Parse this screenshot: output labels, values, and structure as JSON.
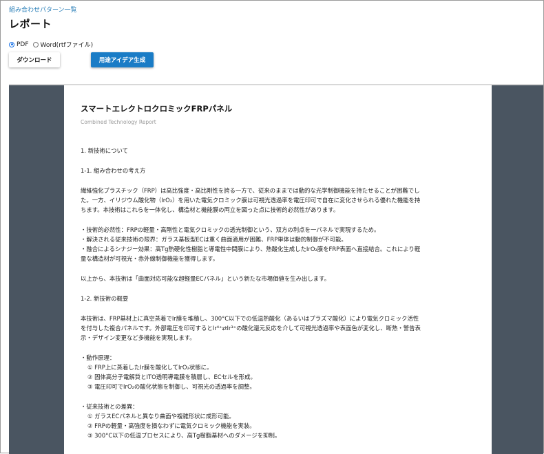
{
  "breadcrumb": "組み合わせパターン一覧",
  "page_title": "レポート",
  "format": {
    "options": [
      {
        "label": "PDF",
        "selected": true
      },
      {
        "label": "Word(rtfファイル)",
        "selected": false
      }
    ]
  },
  "buttons": {
    "download": "ダウンロード",
    "generate": "用途アイデア生成"
  },
  "colors": {
    "link": "#2a7fb8",
    "primary_button": "#1a7cc6",
    "viewer_background": "#4a5561"
  },
  "document": {
    "title": "スマートエレクトロクロミックFRPパネル",
    "subtitle": "Combined Technology Report",
    "lines": [
      "1. 新技術について",
      "",
      "1-1. 組み合わせの考え方",
      "",
      "繊維強化プラスチック（FRP）は高比強度・高比剛性を誇る一方で、従来のままでは動的な光学制御機能を持たせることが困難でし",
      "た。一方、イリジウム酸化物（IrO₂）を用いた電気クロミック膜は可視光透過率を電圧印可で自在に変化させられる優れた機能を持",
      "ちます。本技術はこれらを一体化し、構造材と機能膜の両立を図った点に技術的必然性があります。",
      "",
      "・技術的必然性：FRPの軽量・高剛性と電気クロミックの透光制御という、双方の利点を一パネルで実現するため。",
      "・解決される従来技術の限界：ガラス基板型ECは重く曲面適用が困難、FRP単体は動的制御が不可能。",
      "・融合によるシナジー効果：高Tg熱硬化性樹脂と導電性中間膜により、熱酸化生成したIrO₂膜をFRP表面へ直接結合。これにより軽",
      "量な構造材が可視光・赤外線制御機能を獲得します。",
      "",
      "以上から、本技術は「曲面対応可能な超軽量ECパネル」という新たな市場価値を生み出します。",
      "",
      "1-2. 新技術の概要",
      "",
      "本技術は、FRP基材上に真空蒸着でIr膜を堆積し、300°C以下での低温熱酸化（あるいはプラズマ酸化）により電気クロミック活性",
      "を付与した複合パネルです。外部電圧を印可するとIr⁴⁺⇄Ir³⁺の酸化還元反応を介して可視光透過率や表面色が変化し、断熱・警告表",
      "示・デザイン変更など多機能を実現します。",
      "",
      "・動作原理：",
      "① FRP上に蒸着したIr膜を酸化してIrO₂状態に。",
      "② 固体高分子電解質とITO透明導電膜を積層し、ECセルを形成。",
      "③ 電圧印可でIrO₂の酸化状態を制御し、可視光の透過率を調整。",
      "",
      "・従来技術との差異：",
      "① ガラスECパネルと異なり曲面や複雑形状に成形可能。",
      "② FRPの軽量・高強度を損なわずに電気クロミック機能を実装。",
      "③ 300°C以下の低温プロセスにより、高Tg樹脂基材へのダメージを抑制。"
    ]
  }
}
